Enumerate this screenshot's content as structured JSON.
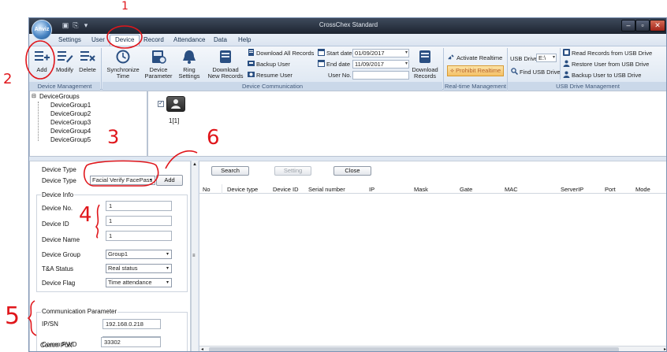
{
  "window": {
    "title": "CrossChex Standard",
    "logo_text": "Anviz"
  },
  "menu_tabs": [
    "Settings",
    "User",
    "Device",
    "Record",
    "Attendance",
    "Data",
    "Help"
  ],
  "ribbon": {
    "device_management": {
      "label": "Device Management",
      "buttons": [
        "Add",
        "Modify",
        "Delete"
      ]
    },
    "device_communication": {
      "label": "Device Communication",
      "sync_time": "Synchronize Time",
      "device_parameter": "Device Parameter",
      "ring_settings": "Ring Settings",
      "download_new_records": "Download New Records",
      "download_all_records": "Download All Records",
      "backup_user": "Backup User",
      "resume_user": "Resume User",
      "start_date_label": "Start date",
      "start_date_value": "01/09/2017",
      "end_date_label": "End date",
      "end_date_value": "11/09/2017",
      "user_no_label": "User No.",
      "user_no_value": "",
      "download_records": "Download Records"
    },
    "realtime_management": {
      "label": "Real-time Management",
      "activate_realtime": "Activate Realtime",
      "prohibit_realtime": "Prohibit Realtime"
    },
    "usb_drive_management": {
      "label": "USB Drive Management",
      "usb_drive_label": "USB Drive",
      "usb_drive_value": "E:\\",
      "find_usb_drive": "Find USB Drive",
      "read_records": "Read Records from USB Drive",
      "restore_user": "Restore User from USB Drive",
      "backup_user_to_usb": "Backup User to USB Drive"
    }
  },
  "tree": {
    "root": "DeviceGroups",
    "children": [
      "DeviceGroup1",
      "DeviceGroup2",
      "DeviceGroup3",
      "DeviceGroup4",
      "DeviceGroup5"
    ]
  },
  "device_tile": {
    "label": "1[1]",
    "checked": true
  },
  "form": {
    "device_type_section": "Device Type",
    "device_type_label": "Device Type",
    "device_type_value": "Facial Verify FacePass",
    "add_button": "Add",
    "device_info_section": "Device Info",
    "device_no_label": "Device No.",
    "device_no_value": "1",
    "device_id_label": "Device ID",
    "device_id_value": "1",
    "device_name_label": "Device Name",
    "device_name_value": "1",
    "device_group_label": "Device Group",
    "device_group_value": "Group1",
    "ta_status_label": "T&A Status",
    "ta_status_value": "Real status",
    "device_flag_label": "Device Flag",
    "device_flag_value": "Time attendance",
    "comm_section": "Communication Parameter",
    "ip_sn_label": "IP/SN",
    "ip_sn_value": "192.168.0.218",
    "comm_pwd_label": "Comm PWD",
    "comm_pwd_value": "",
    "comm_port_label": "Comm Port",
    "comm_port_value": "33302"
  },
  "search_panel": {
    "search_button": "Search",
    "setting_button": "Setting",
    "close_button": "Close",
    "columns": [
      "No",
      "Device type",
      "Device ID",
      "Serial number",
      "IP",
      "Mask",
      "Gate",
      "MAC",
      "ServerIP",
      "Port",
      "Mode"
    ]
  },
  "annotations": [
    "1",
    "2",
    "3",
    "4",
    "5",
    "6"
  ],
  "colors": {
    "annotation": "#e0161b",
    "titlebar": "#1d2430",
    "ribbon": "#dbe5f1"
  }
}
